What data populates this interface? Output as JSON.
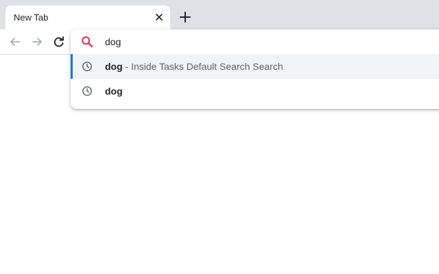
{
  "tab": {
    "title": "New Tab"
  },
  "omnibox": {
    "value": "dog"
  },
  "suggestions": [
    {
      "match": "dog",
      "separator": " - ",
      "description": "Inside Tasks Default Search Search"
    },
    {
      "match": "dog"
    }
  ],
  "icons": {
    "close": "close-icon",
    "new_tab": "plus-icon",
    "back": "arrow-left-icon",
    "forward": "arrow-right-icon",
    "reload": "reload-icon",
    "search": "search-icon",
    "history": "clock-icon"
  },
  "colors": {
    "search_icon": "#e8345a",
    "selection_indicator": "#1a73e8",
    "tabstrip_bg": "#dee1e6"
  }
}
